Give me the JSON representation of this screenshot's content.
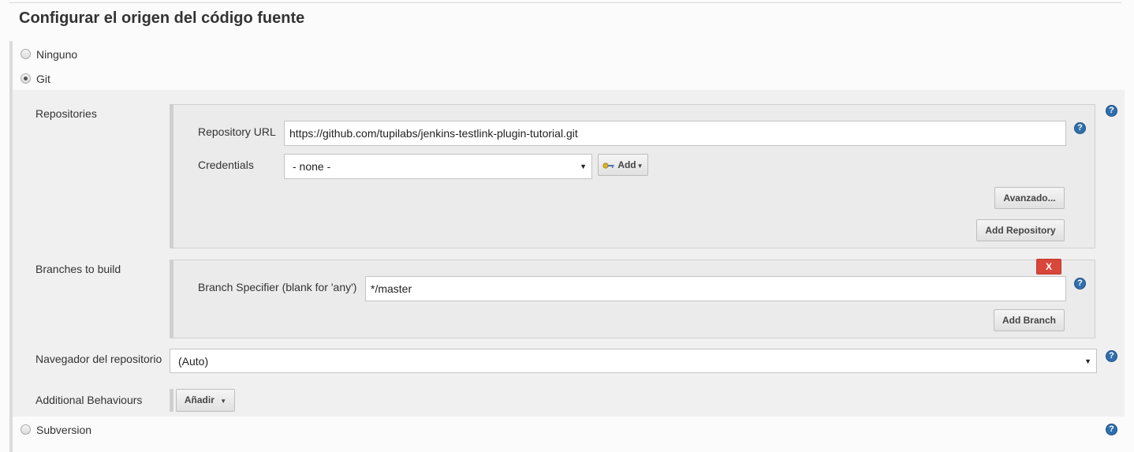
{
  "section": {
    "title": "Configurar el origen del código fuente"
  },
  "scm_options": {
    "none_label": "Ninguno",
    "git_label": "Git",
    "svn_label": "Subversion",
    "selected": "Git"
  },
  "git": {
    "repositories_label": "Repositories",
    "repository_url_label": "Repository URL",
    "repository_url_value": "https://github.com/tupilabs/jenkins-testlink-plugin-tutorial.git",
    "credentials_label": "Credentials",
    "credentials_value": "- none -",
    "add_credentials_label": "Add",
    "advanced_label": "Avanzado...",
    "add_repository_label": "Add Repository",
    "branches_label": "Branches to build",
    "branch_specifier_label": "Branch Specifier (blank for 'any')",
    "branch_specifier_value": "*/master",
    "delete_branch_label": "X",
    "add_branch_label": "Add Branch",
    "repo_browser_label": "Navegador del repositorio",
    "repo_browser_value": "(Auto)",
    "additional_behaviours_label": "Additional Behaviours",
    "add_behaviour_label": "Añadir"
  },
  "icons": {
    "help": "help-icon",
    "key": "key-icon",
    "dropdown": "chevron-down-icon"
  },
  "colors": {
    "help_blue": "#2f6fae",
    "delete_red": "#d9463a",
    "panel_gray": "#ebebeb"
  }
}
